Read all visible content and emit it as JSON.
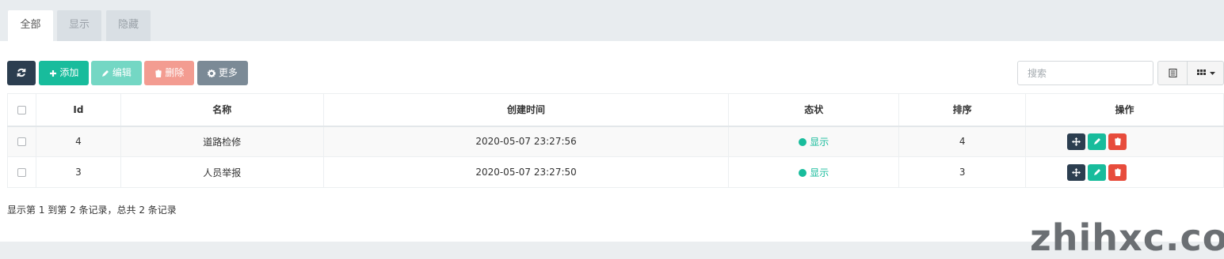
{
  "tabs": [
    {
      "label": "全部",
      "active": true
    },
    {
      "label": "显示",
      "active": false
    },
    {
      "label": "隐藏",
      "active": false
    }
  ],
  "toolbar": {
    "refresh_icon": "refresh-icon",
    "add_label": "添加",
    "edit_label": "编辑",
    "delete_label": "删除",
    "more_label": "更多"
  },
  "search": {
    "placeholder": "搜索"
  },
  "table": {
    "headers": [
      "Id",
      "名称",
      "创建时间",
      "态状",
      "排序",
      "操作"
    ],
    "rows": [
      {
        "id": "4",
        "name": "道路检修",
        "created": "2020-05-07 23:27:56",
        "status": "显示",
        "sort": "4"
      },
      {
        "id": "3",
        "name": "人员举报",
        "created": "2020-05-07 23:27:50",
        "status": "显示",
        "sort": "3"
      }
    ]
  },
  "pagination": {
    "summary": "显示第 1 到第 2 条记录，总共 2 条记录"
  },
  "watermark": "zhihxc.com",
  "colors": {
    "primary": "#18bc9c",
    "dark": "#2c3e50",
    "danger": "#e74c3c",
    "gray": "#7b8a96"
  }
}
